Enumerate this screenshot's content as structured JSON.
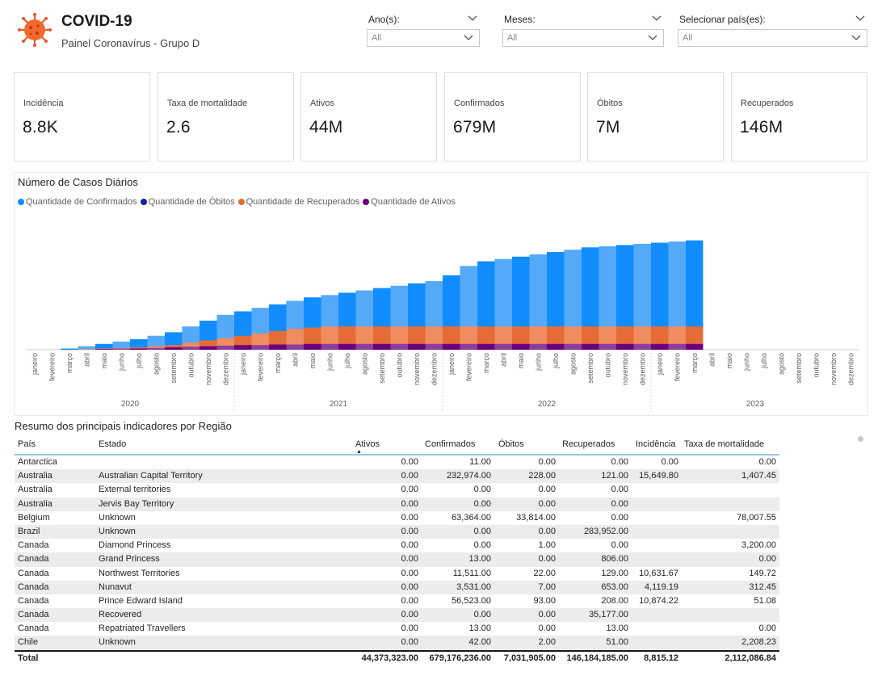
{
  "header": {
    "title": "COVID-19",
    "subtitle": "Painel Coronavírus - Grupo D"
  },
  "slicers": [
    {
      "label": "Ano(s):",
      "value": "All"
    },
    {
      "label": "Meses:",
      "value": "All"
    },
    {
      "label": "Selecionar país(es):",
      "value": "All"
    }
  ],
  "kpis": [
    {
      "label": "Incidência",
      "value": "8.8K"
    },
    {
      "label": "Taxa de mortalidade",
      "value": "2.6"
    },
    {
      "label": "Ativos",
      "value": "44M"
    },
    {
      "label": "Confirmados",
      "value": "679M"
    },
    {
      "label": "Óbitos",
      "value": "7M"
    },
    {
      "label": "Recuperados",
      "value": "146M"
    }
  ],
  "chart_data": {
    "type": "area",
    "title": "Número de Casos Diários",
    "legend_position": "top-left",
    "series": [
      {
        "name": "Quantidade de Confirmados",
        "color": "#118dff"
      },
      {
        "name": "Quantidade de Óbitos",
        "color": "#12239e"
      },
      {
        "name": "Quantidade de Recuperados",
        "color": "#e66c37"
      },
      {
        "name": "Quantidade de Ativos",
        "color": "#6b007b"
      }
    ],
    "x_months": [
      "janeiro",
      "fevereiro",
      "março",
      "abril",
      "maio",
      "junho",
      "julho",
      "agosto",
      "setembro",
      "outubro",
      "novembro",
      "dezembro",
      "janeiro",
      "fevereiro",
      "março",
      "abril",
      "maio",
      "junho",
      "julho",
      "agosto",
      "setembro",
      "outubro",
      "novembro",
      "dezembro",
      "janeiro",
      "fevereiro",
      "março",
      "abril",
      "maio",
      "junho",
      "julho",
      "agosto",
      "setembro",
      "outubro",
      "novembro",
      "dezembro",
      "janeiro",
      "fevereiro",
      "março",
      "abril",
      "maio",
      "junho",
      "julho",
      "agosto",
      "setembro",
      "outubro",
      "novembro",
      "dezembro"
    ],
    "x_years": [
      "2020",
      "2021",
      "2022",
      "2023"
    ],
    "confirmed_rel": [
      0,
      0,
      0.01,
      0.03,
      0.05,
      0.07,
      0.09,
      0.12,
      0.15,
      0.2,
      0.25,
      0.3,
      0.33,
      0.36,
      0.39,
      0.42,
      0.45,
      0.47,
      0.49,
      0.51,
      0.53,
      0.55,
      0.57,
      0.59,
      0.64,
      0.72,
      0.76,
      0.78,
      0.8,
      0.82,
      0.84,
      0.86,
      0.88,
      0.89,
      0.9,
      0.91,
      0.92,
      0.93,
      0.94,
      0,
      0,
      0,
      0,
      0,
      0,
      0,
      0,
      0
    ],
    "recovered_rel": [
      0,
      0,
      0,
      0.005,
      0.01,
      0.015,
      0.02,
      0.03,
      0.04,
      0.06,
      0.08,
      0.1,
      0.12,
      0.14,
      0.16,
      0.18,
      0.19,
      0.2,
      0.2,
      0.2,
      0.2,
      0.2,
      0.2,
      0.2,
      0.2,
      0.2,
      0.2,
      0.2,
      0.2,
      0.2,
      0.2,
      0.2,
      0.2,
      0.2,
      0.2,
      0.2,
      0.2,
      0.2,
      0.2,
      0,
      0,
      0,
      0,
      0,
      0,
      0,
      0,
      0
    ],
    "active_rel": [
      0,
      0,
      0,
      0,
      0.005,
      0.01,
      0.01,
      0.015,
      0.02,
      0.025,
      0.03,
      0.035,
      0.04,
      0.04,
      0.045,
      0.045,
      0.05,
      0.05,
      0.05,
      0.05,
      0.05,
      0.05,
      0.05,
      0.05,
      0.05,
      0.05,
      0.05,
      0.05,
      0.05,
      0.05,
      0.05,
      0.05,
      0.05,
      0.05,
      0.05,
      0.05,
      0.05,
      0.05,
      0.05,
      0,
      0,
      0,
      0,
      0,
      0,
      0,
      0,
      0
    ]
  },
  "table": {
    "title": "Resumo dos principais indicadores por Região",
    "columns": [
      "País",
      "Estado",
      "Ativos",
      "Confirmados",
      "Óbitos",
      "Recuperados",
      "Incidência",
      "Taxa de mortalidade"
    ],
    "rows": [
      [
        "Antarctica",
        "",
        "0.00",
        "11.00",
        "0.00",
        "0.00",
        "0.00",
        "0.00"
      ],
      [
        "Australia",
        "Australian Capital Territory",
        "0.00",
        "232,974.00",
        "228.00",
        "121.00",
        "15,649.80",
        "1,407.45"
      ],
      [
        "Australia",
        "External territories",
        "0.00",
        "0.00",
        "0.00",
        "0.00",
        "",
        ""
      ],
      [
        "Australia",
        "Jervis Bay Territory",
        "0.00",
        "0.00",
        "0.00",
        "0.00",
        "",
        ""
      ],
      [
        "Belgium",
        "Unknown",
        "0.00",
        "63,364.00",
        "33,814.00",
        "0.00",
        "",
        "78,007.55"
      ],
      [
        "Brazil",
        "Unknown",
        "0.00",
        "0.00",
        "0.00",
        "283,952.00",
        "",
        ""
      ],
      [
        "Canada",
        "Diamond Princess",
        "0.00",
        "0.00",
        "1.00",
        "0.00",
        "",
        "3,200.00"
      ],
      [
        "Canada",
        "Grand Princess",
        "0.00",
        "13.00",
        "0.00",
        "806.00",
        "",
        "0.00"
      ],
      [
        "Canada",
        "Northwest Territories",
        "0.00",
        "11,511.00",
        "22.00",
        "129.00",
        "10,631.67",
        "149.72"
      ],
      [
        "Canada",
        "Nunavut",
        "0.00",
        "3,531.00",
        "7.00",
        "653.00",
        "4,119.19",
        "312.45"
      ],
      [
        "Canada",
        "Prince Edward Island",
        "0.00",
        "56,523.00",
        "93.00",
        "208.00",
        "10,874.22",
        "51.08"
      ],
      [
        "Canada",
        "Recovered",
        "0.00",
        "0.00",
        "0.00",
        "35,177.00",
        "",
        ""
      ],
      [
        "Canada",
        "Repatriated Travellers",
        "0.00",
        "13.00",
        "0.00",
        "13.00",
        "",
        "0.00"
      ],
      [
        "Chile",
        "Unknown",
        "0.00",
        "42.00",
        "2.00",
        "51.00",
        "",
        "2,208.23"
      ]
    ],
    "total": [
      "Total",
      "",
      "44,373,323.00",
      "679,176,236.00",
      "7,031,905.00",
      "146,184,185.00",
      "8,815.12",
      "2,112,086.84"
    ]
  }
}
